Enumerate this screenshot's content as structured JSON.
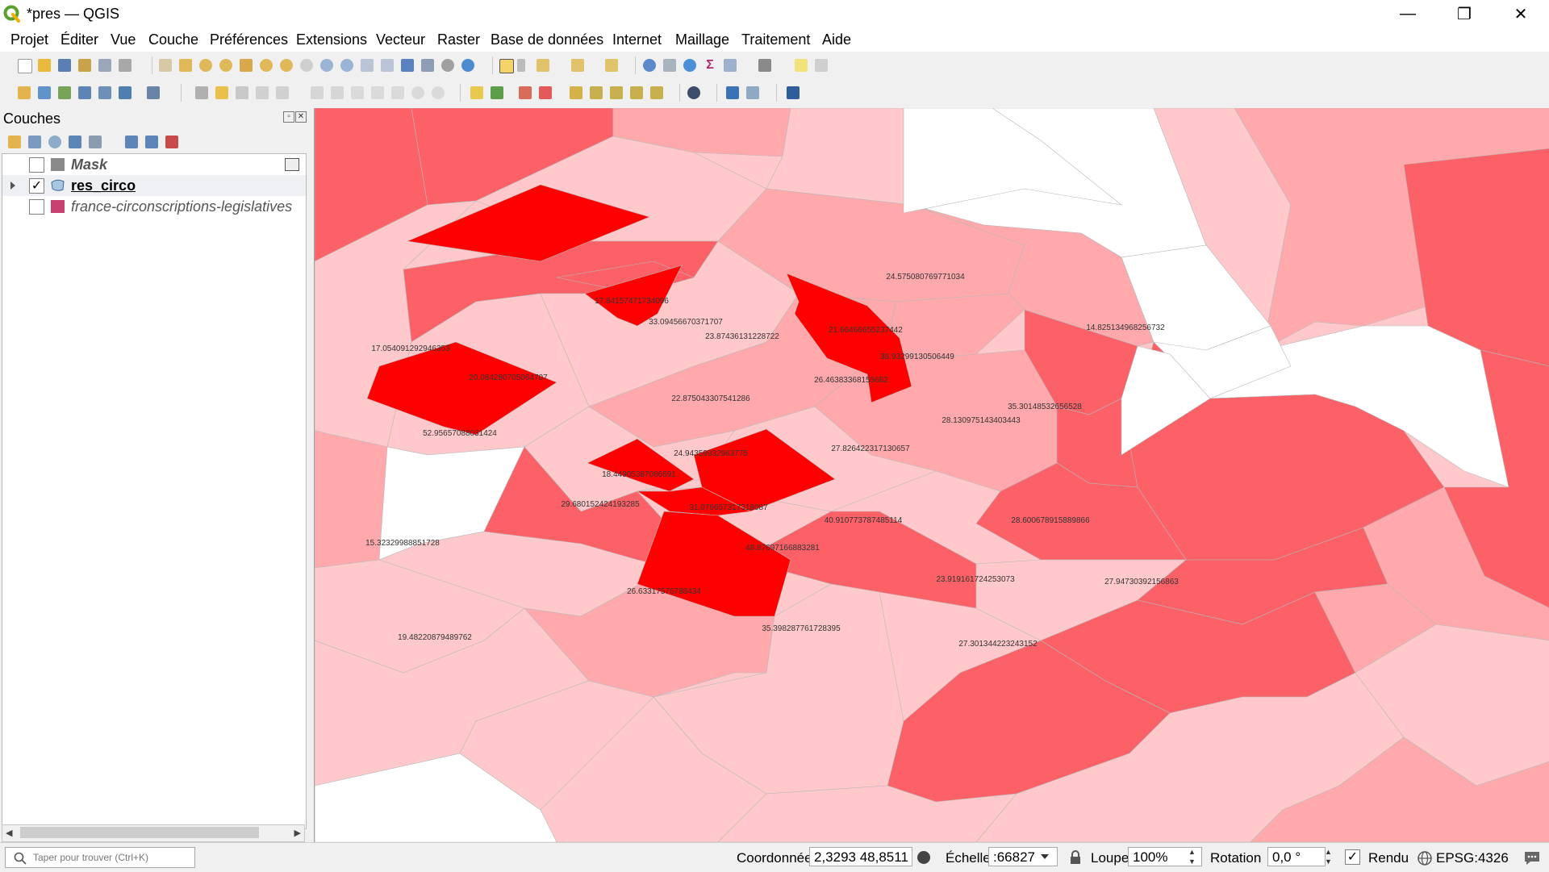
{
  "window": {
    "title": "*pres — QGIS",
    "minimize_glyph": "—",
    "restore_glyph": "❐",
    "close_glyph": "✕"
  },
  "menu": [
    "Projet",
    "Éditer",
    "Vue",
    "Couche",
    "Préférences",
    "Extensions",
    "Vecteur",
    "Raster",
    "Base de données",
    "Internet",
    "Maillage",
    "Traitement",
    "Aide"
  ],
  "layers_panel": {
    "title": "Couches",
    "layers": [
      {
        "name": "Mask",
        "checked": false,
        "icon": "polygon-gray-icon",
        "color": "#8a8a8a"
      },
      {
        "name": "res_circo",
        "checked": true,
        "icon": "polygon-blue-icon",
        "color": "#7fa6c9"
      },
      {
        "name": "france-circonscriptions-legislatives",
        "checked": false,
        "icon": "polygon-pink-icon",
        "color": "#c7406f"
      }
    ]
  },
  "map": {
    "labels": [
      "24.575080769771034",
      "14.825134968256732",
      "17.84157471734096",
      "33.09456670371707",
      "23.87436131228722",
      "21.66466655237442",
      "17.054091292946353",
      "20.084280705064707",
      "38.93299130506449",
      "26.46383368155682",
      "22.875043307541286",
      "52.95657088031424",
      "28.130975143403443",
      "35.30148532656528",
      "27.826422317130657",
      "24.94359932963775",
      "18.44905387086591",
      "29.680152424193285",
      "31.076657317318087",
      "40.910773787485114",
      "28.600678915889866",
      "15.32329988851728",
      "48.87697166883281",
      "23.919161724253073",
      "27.94730392156863",
      "26.63317576788434",
      "19.48220879489762",
      "35.398287761728395",
      "27.301344223243152"
    ]
  },
  "status": {
    "search_placeholder": "Taper pour trouver (Ctrl+K)",
    "coord_label": "Coordonnée",
    "coord_value": "2,3293 48,8511",
    "scale_label": "Échelle",
    "scale_value": ":66827",
    "magnifier_label": "Loupe",
    "magnifier_value": "100%",
    "rotation_label": "Rotation",
    "rotation_value": "0,0 °",
    "render_label": "Rendu",
    "crs": "EPSG:4326"
  }
}
